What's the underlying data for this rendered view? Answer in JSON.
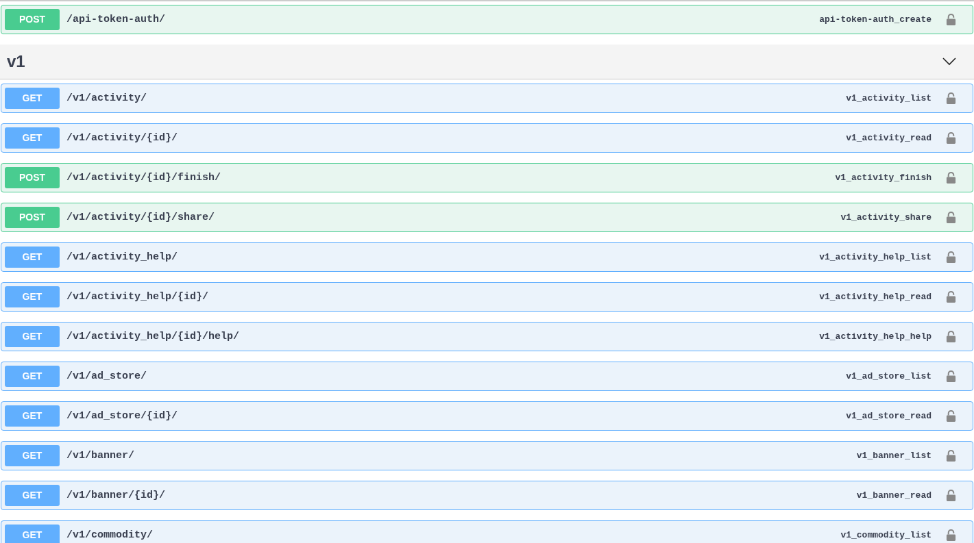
{
  "top_operations": [
    {
      "kind": "post",
      "method": "POST",
      "path": "/api-token-auth/",
      "operation_id": "api-token-auth_create"
    }
  ],
  "section": {
    "title": "v1",
    "expanded": true,
    "operations": [
      {
        "kind": "get",
        "method": "GET",
        "path": "/v1/activity/",
        "operation_id": "v1_activity_list"
      },
      {
        "kind": "get",
        "method": "GET",
        "path": "/v1/activity/{id}/",
        "operation_id": "v1_activity_read"
      },
      {
        "kind": "post",
        "method": "POST",
        "path": "/v1/activity/{id}/finish/",
        "operation_id": "v1_activity_finish"
      },
      {
        "kind": "post",
        "method": "POST",
        "path": "/v1/activity/{id}/share/",
        "operation_id": "v1_activity_share"
      },
      {
        "kind": "get",
        "method": "GET",
        "path": "/v1/activity_help/",
        "operation_id": "v1_activity_help_list"
      },
      {
        "kind": "get",
        "method": "GET",
        "path": "/v1/activity_help/{id}/",
        "operation_id": "v1_activity_help_read"
      },
      {
        "kind": "get",
        "method": "GET",
        "path": "/v1/activity_help/{id}/help/",
        "operation_id": "v1_activity_help_help"
      },
      {
        "kind": "get",
        "method": "GET",
        "path": "/v1/ad_store/",
        "operation_id": "v1_ad_store_list"
      },
      {
        "kind": "get",
        "method": "GET",
        "path": "/v1/ad_store/{id}/",
        "operation_id": "v1_ad_store_read"
      },
      {
        "kind": "get",
        "method": "GET",
        "path": "/v1/banner/",
        "operation_id": "v1_banner_list"
      },
      {
        "kind": "get",
        "method": "GET",
        "path": "/v1/banner/{id}/",
        "operation_id": "v1_banner_read"
      },
      {
        "kind": "get",
        "method": "GET",
        "path": "/v1/commodity/",
        "operation_id": "v1_commodity_list"
      }
    ]
  }
}
